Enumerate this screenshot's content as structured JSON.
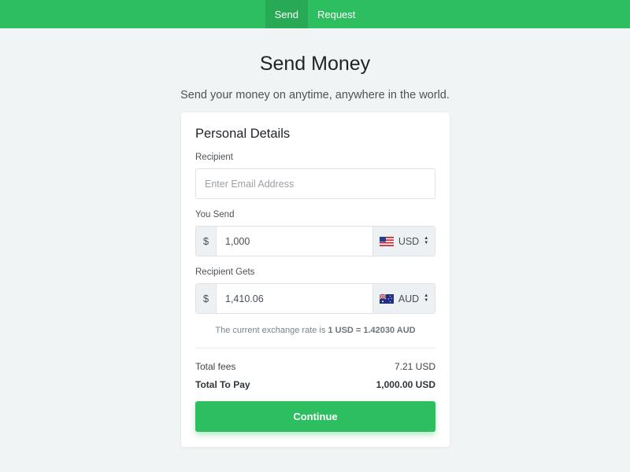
{
  "nav": {
    "tabs": [
      {
        "label": "Send",
        "active": true
      },
      {
        "label": "Request",
        "active": false
      }
    ]
  },
  "header": {
    "title": "Send Money",
    "subtitle": "Send your money on anytime, anywhere in the world."
  },
  "form": {
    "title": "Personal Details",
    "recipient": {
      "label": "Recipient",
      "placeholder": "Enter Email Address",
      "value": ""
    },
    "you_send": {
      "label": "You Send",
      "prefix": "$",
      "value": "1,000",
      "currency": "USD",
      "flag_icon": "us-flag-icon"
    },
    "recipient_gets": {
      "label": "Recipient Gets",
      "prefix": "$",
      "value": "1,410.06",
      "currency": "AUD",
      "flag_icon": "au-flag-icon"
    },
    "rate_prefix": "The current exchange rate is",
    "rate_value": "1 USD = 1.42030 AUD",
    "fees_label": "Total fees",
    "fees_value": "7.21 USD",
    "total_label": "Total To Pay",
    "total_value": "1,000.00 USD",
    "continue_label": "Continue"
  },
  "colors": {
    "accent": "#2dbe60",
    "accent_dark": "#27a955",
    "background": "#f0f4f4"
  }
}
